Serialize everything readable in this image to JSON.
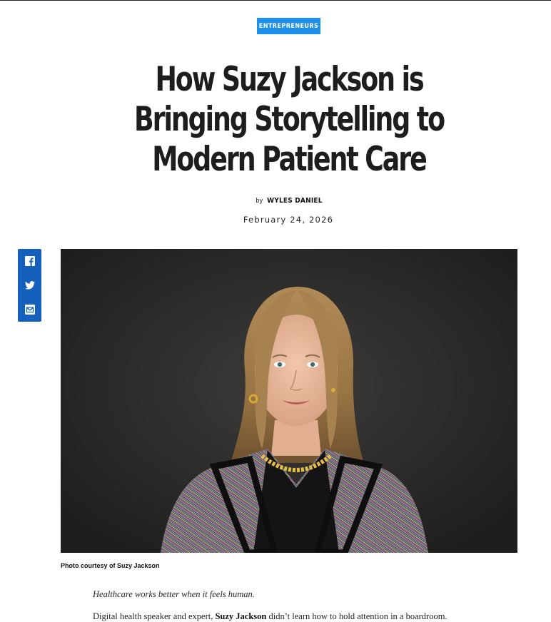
{
  "article": {
    "category": "ENTREPRENEURS",
    "headline": "How Suzy Jackson is Bringing Storytelling to Modern Patient Care",
    "byline_prefix": "by",
    "author": "WYLES DANIEL",
    "date": "February 24, 2026",
    "image_caption": "Photo courtesy of Suzy Jackson",
    "intro": "Healthcare works better when it feels human.",
    "body_start": "Digital health speaker and expert, ",
    "body_link": "Suzy Jackson",
    "body_rest": " didn’t learn how to hold attention in a boardroom."
  },
  "share": {
    "items": [
      {
        "icon": "facebook-icon",
        "label": "Facebook"
      },
      {
        "icon": "twitter-icon",
        "label": "Twitter"
      },
      {
        "icon": "email-icon",
        "label": "Email"
      }
    ]
  },
  "colors": {
    "accent": "#1e90ea",
    "share_bar": "#1560bd",
    "text": "#111111"
  }
}
